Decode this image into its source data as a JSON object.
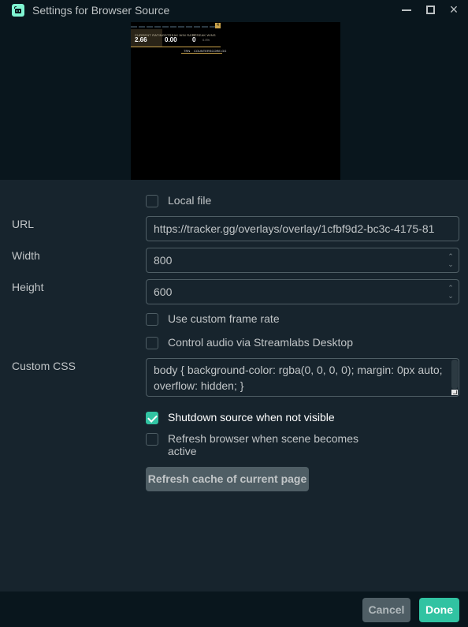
{
  "window": {
    "title": "Settings for Browser Source",
    "icon": "streamlabs-logo-icon",
    "controls": {
      "minimize": "minimize-icon",
      "maximize": "maximize-icon",
      "close": "×"
    }
  },
  "preview": {
    "badge": "4",
    "stats": [
      {
        "label": "CURRENT RATING",
        "value": "2.66",
        "extra": ""
      },
      {
        "label": "STREAK WIN RATE",
        "value": "0.00",
        "extra": ""
      },
      {
        "label": "STREAK WINS",
        "value": "0",
        "extra": "0.0%"
      }
    ],
    "footer_left": "TRN",
    "footer_right": "COUNTERSCORE.GG"
  },
  "form": {
    "local_file": {
      "label": "Local file",
      "checked": false
    },
    "url": {
      "label": "URL",
      "value": "https://tracker.gg/overlays/overlay/1cfbf9d2-bc3c-4175-81"
    },
    "width": {
      "label": "Width",
      "value": "800"
    },
    "height": {
      "label": "Height",
      "value": "600"
    },
    "custom_frame_rate": {
      "label": "Use custom frame rate",
      "checked": false
    },
    "control_audio": {
      "label": "Control audio via Streamlabs Desktop",
      "checked": false
    },
    "custom_css": {
      "label": "Custom CSS",
      "value": "body { background-color: rgba(0, 0, 0, 0); margin: 0px auto; overflow: hidden; }"
    },
    "shutdown_source": {
      "label": "Shutdown source when not visible",
      "checked": true
    },
    "refresh_browser": {
      "label": "Refresh browser when scene becomes active",
      "checked": false
    },
    "refresh_cache_button": "Refresh cache of current page"
  },
  "footer": {
    "cancel": "Cancel",
    "done": "Done"
  },
  "colors": {
    "accent": "#31c3a2",
    "background": "#17242d",
    "titlebar": "#09161d",
    "secondary_button": "#4f5e65"
  }
}
